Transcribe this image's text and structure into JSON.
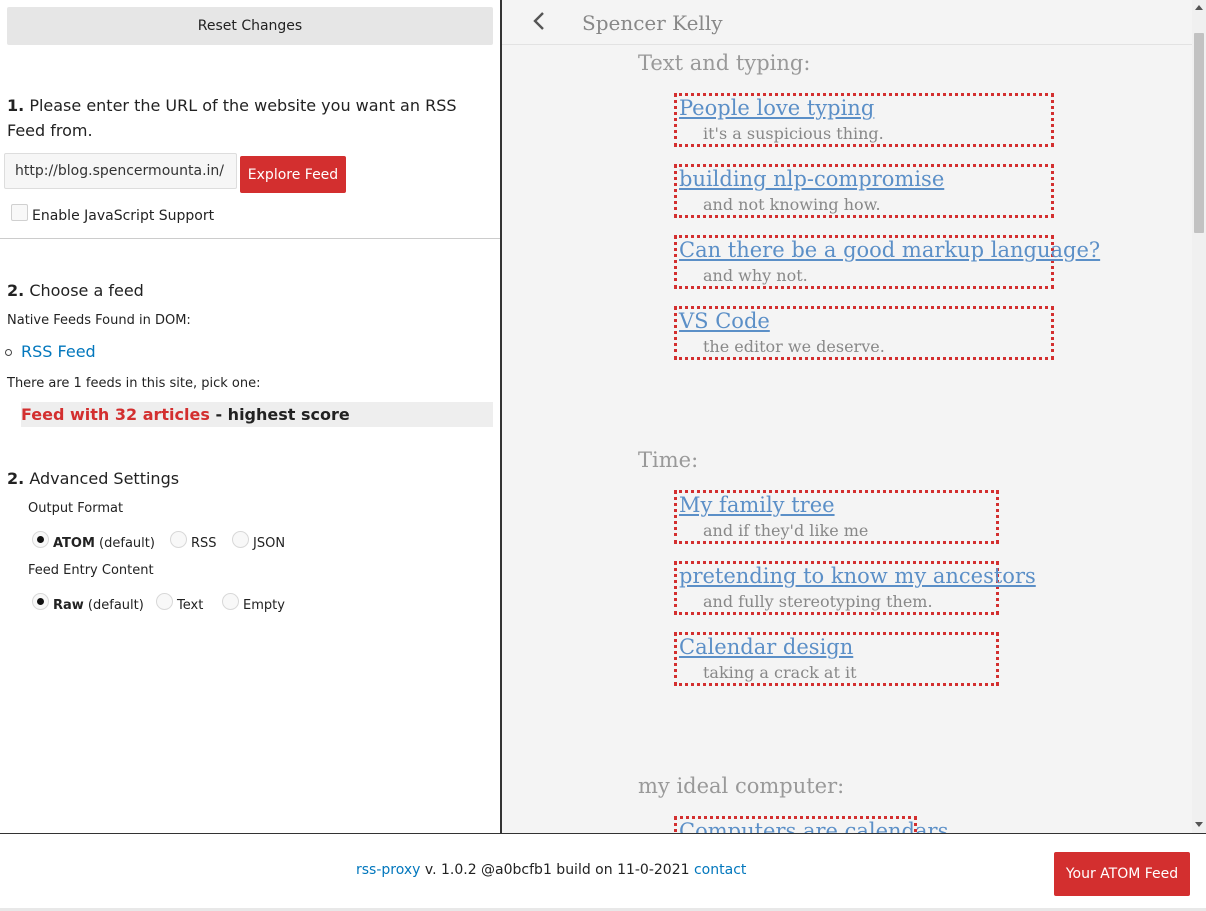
{
  "left": {
    "reset_label": "Reset Changes",
    "step1": {
      "number": "1.",
      "text": "Please enter the URL of the website you want an RSS Feed from."
    },
    "url_value": "http://blog.spencermounta.in/",
    "explore_label": "Explore Feed",
    "js_label": "Enable JavaScript Support",
    "step2": {
      "number": "2.",
      "text": "Choose a feed"
    },
    "native_label": "Native Feeds Found in DOM:",
    "native_feed_link": "RSS Feed",
    "feeds_count_text": "There are 1 feeds in this site, pick one:",
    "feed_option": {
      "title": "Feed with 32 articles",
      "suffix": " - highest score"
    },
    "step3": {
      "number": "2.",
      "text": "Advanced Settings"
    },
    "output_format": {
      "label": "Output Format",
      "options": [
        {
          "bold": "ATOM",
          "rest": " (default)",
          "checked": true
        },
        {
          "bold": "",
          "rest": "RSS",
          "checked": false
        },
        {
          "bold": "",
          "rest": "JSON",
          "checked": false
        }
      ]
    },
    "entry_content": {
      "label": "Feed Entry Content",
      "options": [
        {
          "bold": "Raw",
          "rest": " (default)",
          "checked": true
        },
        {
          "bold": "",
          "rest": "Text",
          "checked": false
        },
        {
          "bold": "",
          "rest": "Empty",
          "checked": false
        }
      ]
    }
  },
  "preview": {
    "site_title": "Spencer Kelly",
    "sections": [
      {
        "title": "Text and typing:",
        "articles": [
          {
            "title": "People love typing",
            "subtitle": "it's a suspicious thing."
          },
          {
            "title": "building nlp-compromise",
            "subtitle": "and not knowing how."
          },
          {
            "title": "Can there be a good markup language?",
            "subtitle": "and why not."
          },
          {
            "title": "VS Code",
            "subtitle": "the editor we deserve."
          }
        ]
      },
      {
        "title": "Time:",
        "articles": [
          {
            "title": "My family tree",
            "subtitle": "and if they'd like me"
          },
          {
            "title": "pretending to know my ancestors",
            "subtitle": "and fully stereotyping them."
          },
          {
            "title": "Calendar design",
            "subtitle": "taking a crack at it"
          }
        ]
      },
      {
        "title": "my ideal computer:",
        "articles": [
          {
            "title": "Computers are calendars",
            "subtitle": ""
          }
        ]
      }
    ]
  },
  "footer": {
    "project_link": "rss-proxy",
    "version_text": " v. 1.0.2 @a0bcfb1 build on 11-0-2021 ",
    "contact_link": "contact",
    "atom_button": "Your ATOM Feed"
  },
  "colors": {
    "accent": "#d32f2f",
    "link": "#0277bd",
    "article_link": "#5b8fc7"
  }
}
